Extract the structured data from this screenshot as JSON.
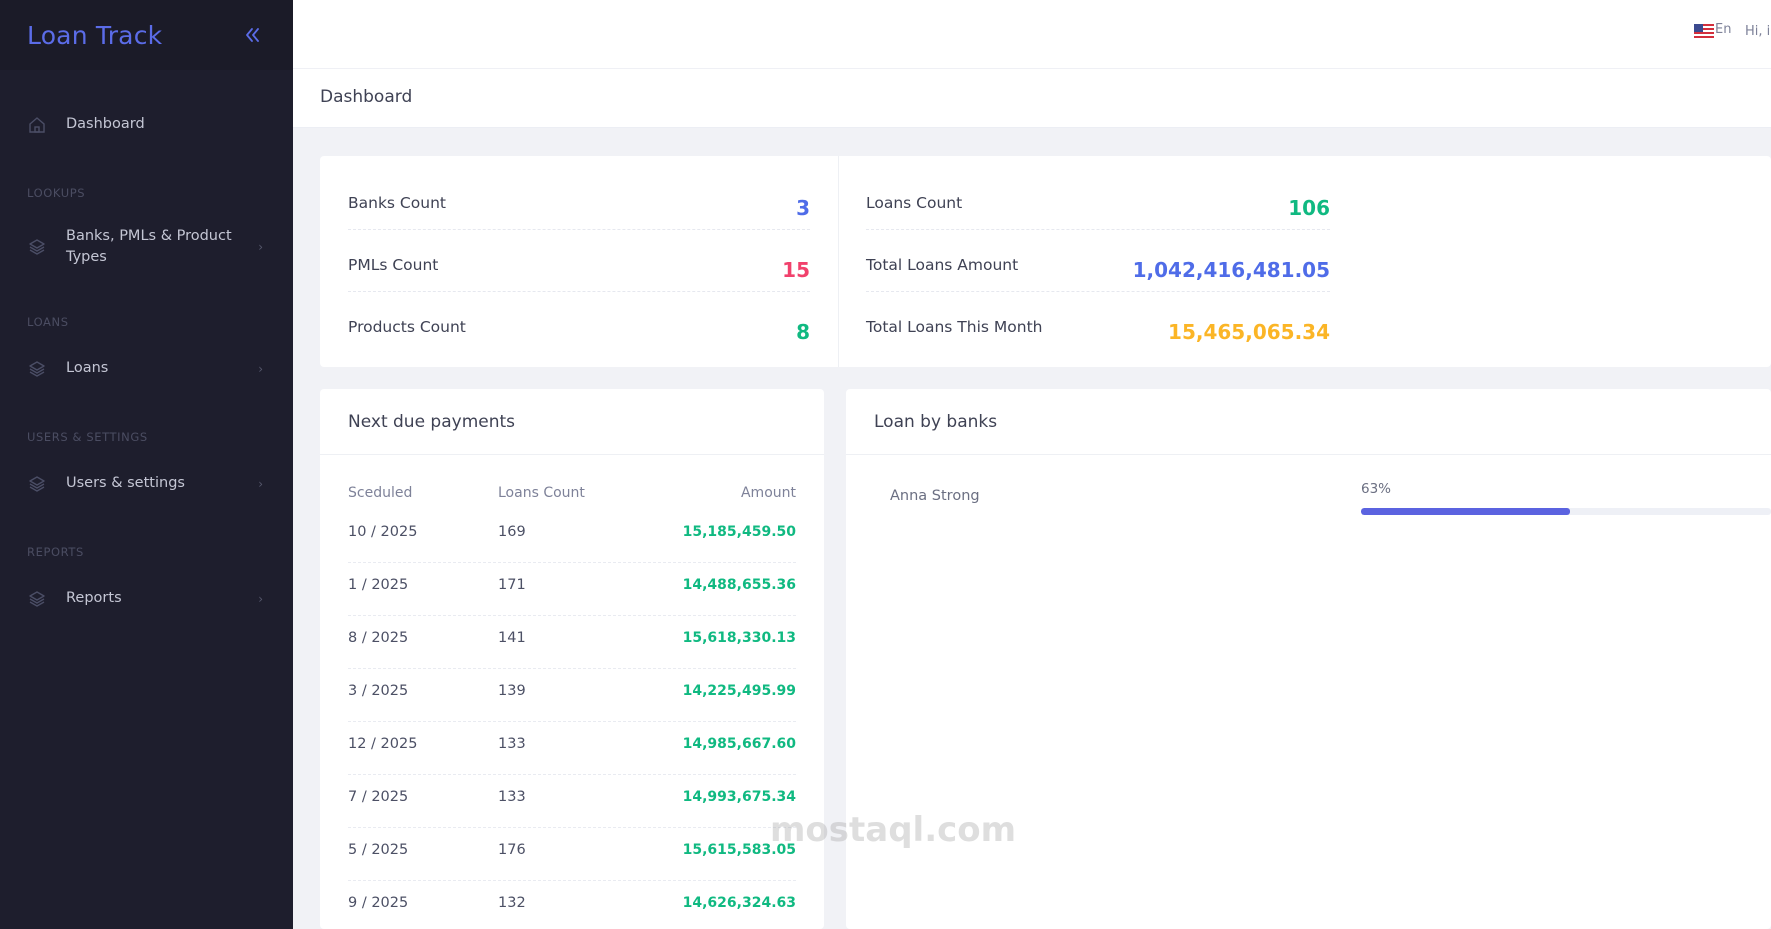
{
  "app": {
    "name": "Loan Track"
  },
  "topbar": {
    "lang_label": "En",
    "greeting": "Hi, i"
  },
  "page": {
    "title": "Dashboard"
  },
  "sidebar": {
    "items": [
      {
        "label": "Dashboard",
        "icon": "home-icon"
      },
      {
        "section": "LOOKUPS"
      },
      {
        "label": "Banks, PMLs & Product Types",
        "icon": "layers-icon"
      },
      {
        "section": "LOANS"
      },
      {
        "label": "Loans",
        "icon": "layers-icon"
      },
      {
        "section": "USERS & SETTINGS"
      },
      {
        "label": "Users & settings",
        "icon": "layers-icon"
      },
      {
        "section": "REPORTS"
      },
      {
        "label": "Reports",
        "icon": "layers-icon"
      }
    ],
    "dashboard_label": "Dashboard",
    "lookups_title": "LOOKUPS",
    "banks_label": "Banks, PMLs & Product Types",
    "loans_title": "LOANS",
    "loans_label": "Loans",
    "users_title": "USERS & SETTINGS",
    "users_label": "Users & settings",
    "reports_title": "REPORTS",
    "reports_label": "Reports"
  },
  "stats": {
    "left": [
      {
        "label": "Banks Count",
        "value": "3",
        "color": "#4f6ce8"
      },
      {
        "label": "PMLs Count",
        "value": "15",
        "color": "#f1416c"
      },
      {
        "label": "Products Count",
        "value": "8",
        "color": "#10b981"
      }
    ],
    "right": [
      {
        "label": "Loans Count",
        "value": "106",
        "color": "#10b981"
      },
      {
        "label": "Total Loans Amount",
        "value": "1,042,416,481.05",
        "color": "#4f6ce8"
      },
      {
        "label": "Total Loans This Month",
        "value": "15,465,065.34",
        "color": "#fbb526"
      }
    ]
  },
  "payments": {
    "title": "Next due payments",
    "columns": {
      "scheduled": "Sceduled",
      "count": "Loans Count",
      "amount": "Amount"
    },
    "rows": [
      {
        "scheduled": "10 / 2025",
        "count": "169",
        "amount": "15,185,459.50"
      },
      {
        "scheduled": "1 / 2025",
        "count": "171",
        "amount": "14,488,655.36"
      },
      {
        "scheduled": "8 / 2025",
        "count": "141",
        "amount": "15,618,330.13"
      },
      {
        "scheduled": "3 / 2025",
        "count": "139",
        "amount": "14,225,495.99"
      },
      {
        "scheduled": "12 / 2025",
        "count": "133",
        "amount": "14,985,667.60"
      },
      {
        "scheduled": "7 / 2025",
        "count": "133",
        "amount": "14,993,675.34"
      },
      {
        "scheduled": "5 / 2025",
        "count": "176",
        "amount": "15,615,583.05"
      },
      {
        "scheduled": "9 / 2025",
        "count": "132",
        "amount": "14,626,324.63"
      }
    ]
  },
  "banks": {
    "title": "Loan by banks",
    "items": [
      {
        "name": "Anna Strong",
        "percent_label": "63%",
        "percent": 63
      }
    ]
  },
  "watermark": {
    "text": "mostaql.com"
  }
}
